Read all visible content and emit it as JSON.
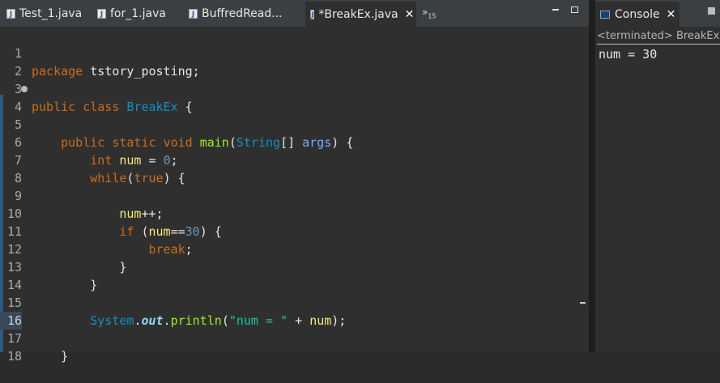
{
  "editor": {
    "tabs": [
      {
        "label": "Test_1.java",
        "active": false
      },
      {
        "label": "for_1.java",
        "active": false
      },
      {
        "label": "BuffredRead...",
        "active": false
      },
      {
        "label": "*BreakEx.java",
        "active": true,
        "close": "✕"
      }
    ],
    "overflow": {
      "label": "»",
      "count": "15"
    },
    "lines": [
      {
        "n": "1"
      },
      {
        "n": "2"
      },
      {
        "n": "3"
      },
      {
        "n": "4"
      },
      {
        "n": "5"
      },
      {
        "n": "6"
      },
      {
        "n": "7"
      },
      {
        "n": "8"
      },
      {
        "n": "9"
      },
      {
        "n": "10"
      },
      {
        "n": "11"
      },
      {
        "n": "12"
      },
      {
        "n": "13"
      },
      {
        "n": "14"
      },
      {
        "n": "15"
      },
      {
        "n": "16"
      },
      {
        "n": "17"
      },
      {
        "n": "18"
      }
    ],
    "code": {
      "l1_kw": "package",
      "l1_rest": " tstory_posting;",
      "l3_kw1": "public",
      "l3_kw2": "class",
      "l3_cls": "BreakEx",
      "l3_rest": " {",
      "l4_kw1": "public",
      "l4_kw2": "static",
      "l4_kw3": "void",
      "l4_mth": "main",
      "l4_p1": "(",
      "l4_cls": "String",
      "l4_p2": "[] ",
      "l4_arg": "args",
      "l4_p3": ") {",
      "l6_kw": "int",
      "l6_var": "num",
      "l6_p1": " = ",
      "l6_num": "0",
      "l6_p2": ";",
      "l7_kw": "while",
      "l7_p1": "(",
      "l7_kw2": "true",
      "l7_p2": ") {",
      "l9_var": "num",
      "l9_p": "++;",
      "l10_kw": "if",
      "l10_p1": " (",
      "l10_var": "num",
      "l10_p2": "==",
      "l10_num": "30",
      "l10_p3": ") {",
      "l11_kw": "break",
      "l11_p": ";",
      "l12_p": "}",
      "l13_p": "}",
      "l15_cls": "System",
      "l15_dot1": ".",
      "l15_fld": "out",
      "l15_dot2": ".",
      "l15_mth": "println",
      "l15_p1": "(",
      "l15_str": "\"num = \"",
      "l15_p2": " + ",
      "l15_var": "num",
      "l15_p3": ");",
      "l17_p": "}"
    }
  },
  "console": {
    "title": "Console",
    "close": "✕",
    "status": "<terminated> BreakEx [Java Application]",
    "output": "num = 30"
  },
  "colors": {
    "keyword": "#cc6c1d",
    "class": "#1290c3",
    "method": "#a7ec21",
    "variable": "#f3ec79",
    "number": "#6897bb",
    "string": "#17c6a3",
    "static_field": "#8ddaf8",
    "background": "#2f2f2f"
  }
}
